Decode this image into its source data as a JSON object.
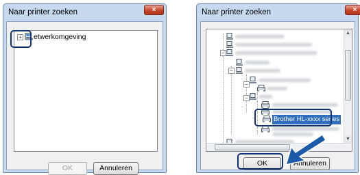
{
  "dialog_left": {
    "title": "Naar printer zoeken",
    "close_label": "×",
    "tree_root_label": "etwerkomgeving",
    "ok_label": "OK",
    "cancel_label": "Annuleren"
  },
  "dialog_right": {
    "title": "Naar printer zoeken",
    "close_label": "×",
    "selected_printer": "Brother HL-xxxx series",
    "ok_label": "OK",
    "cancel_label": "Annuleren"
  },
  "colors": {
    "highlight_border": "#10326e",
    "selection": "#2f6fbe",
    "arrow": "#1a5aa8"
  }
}
